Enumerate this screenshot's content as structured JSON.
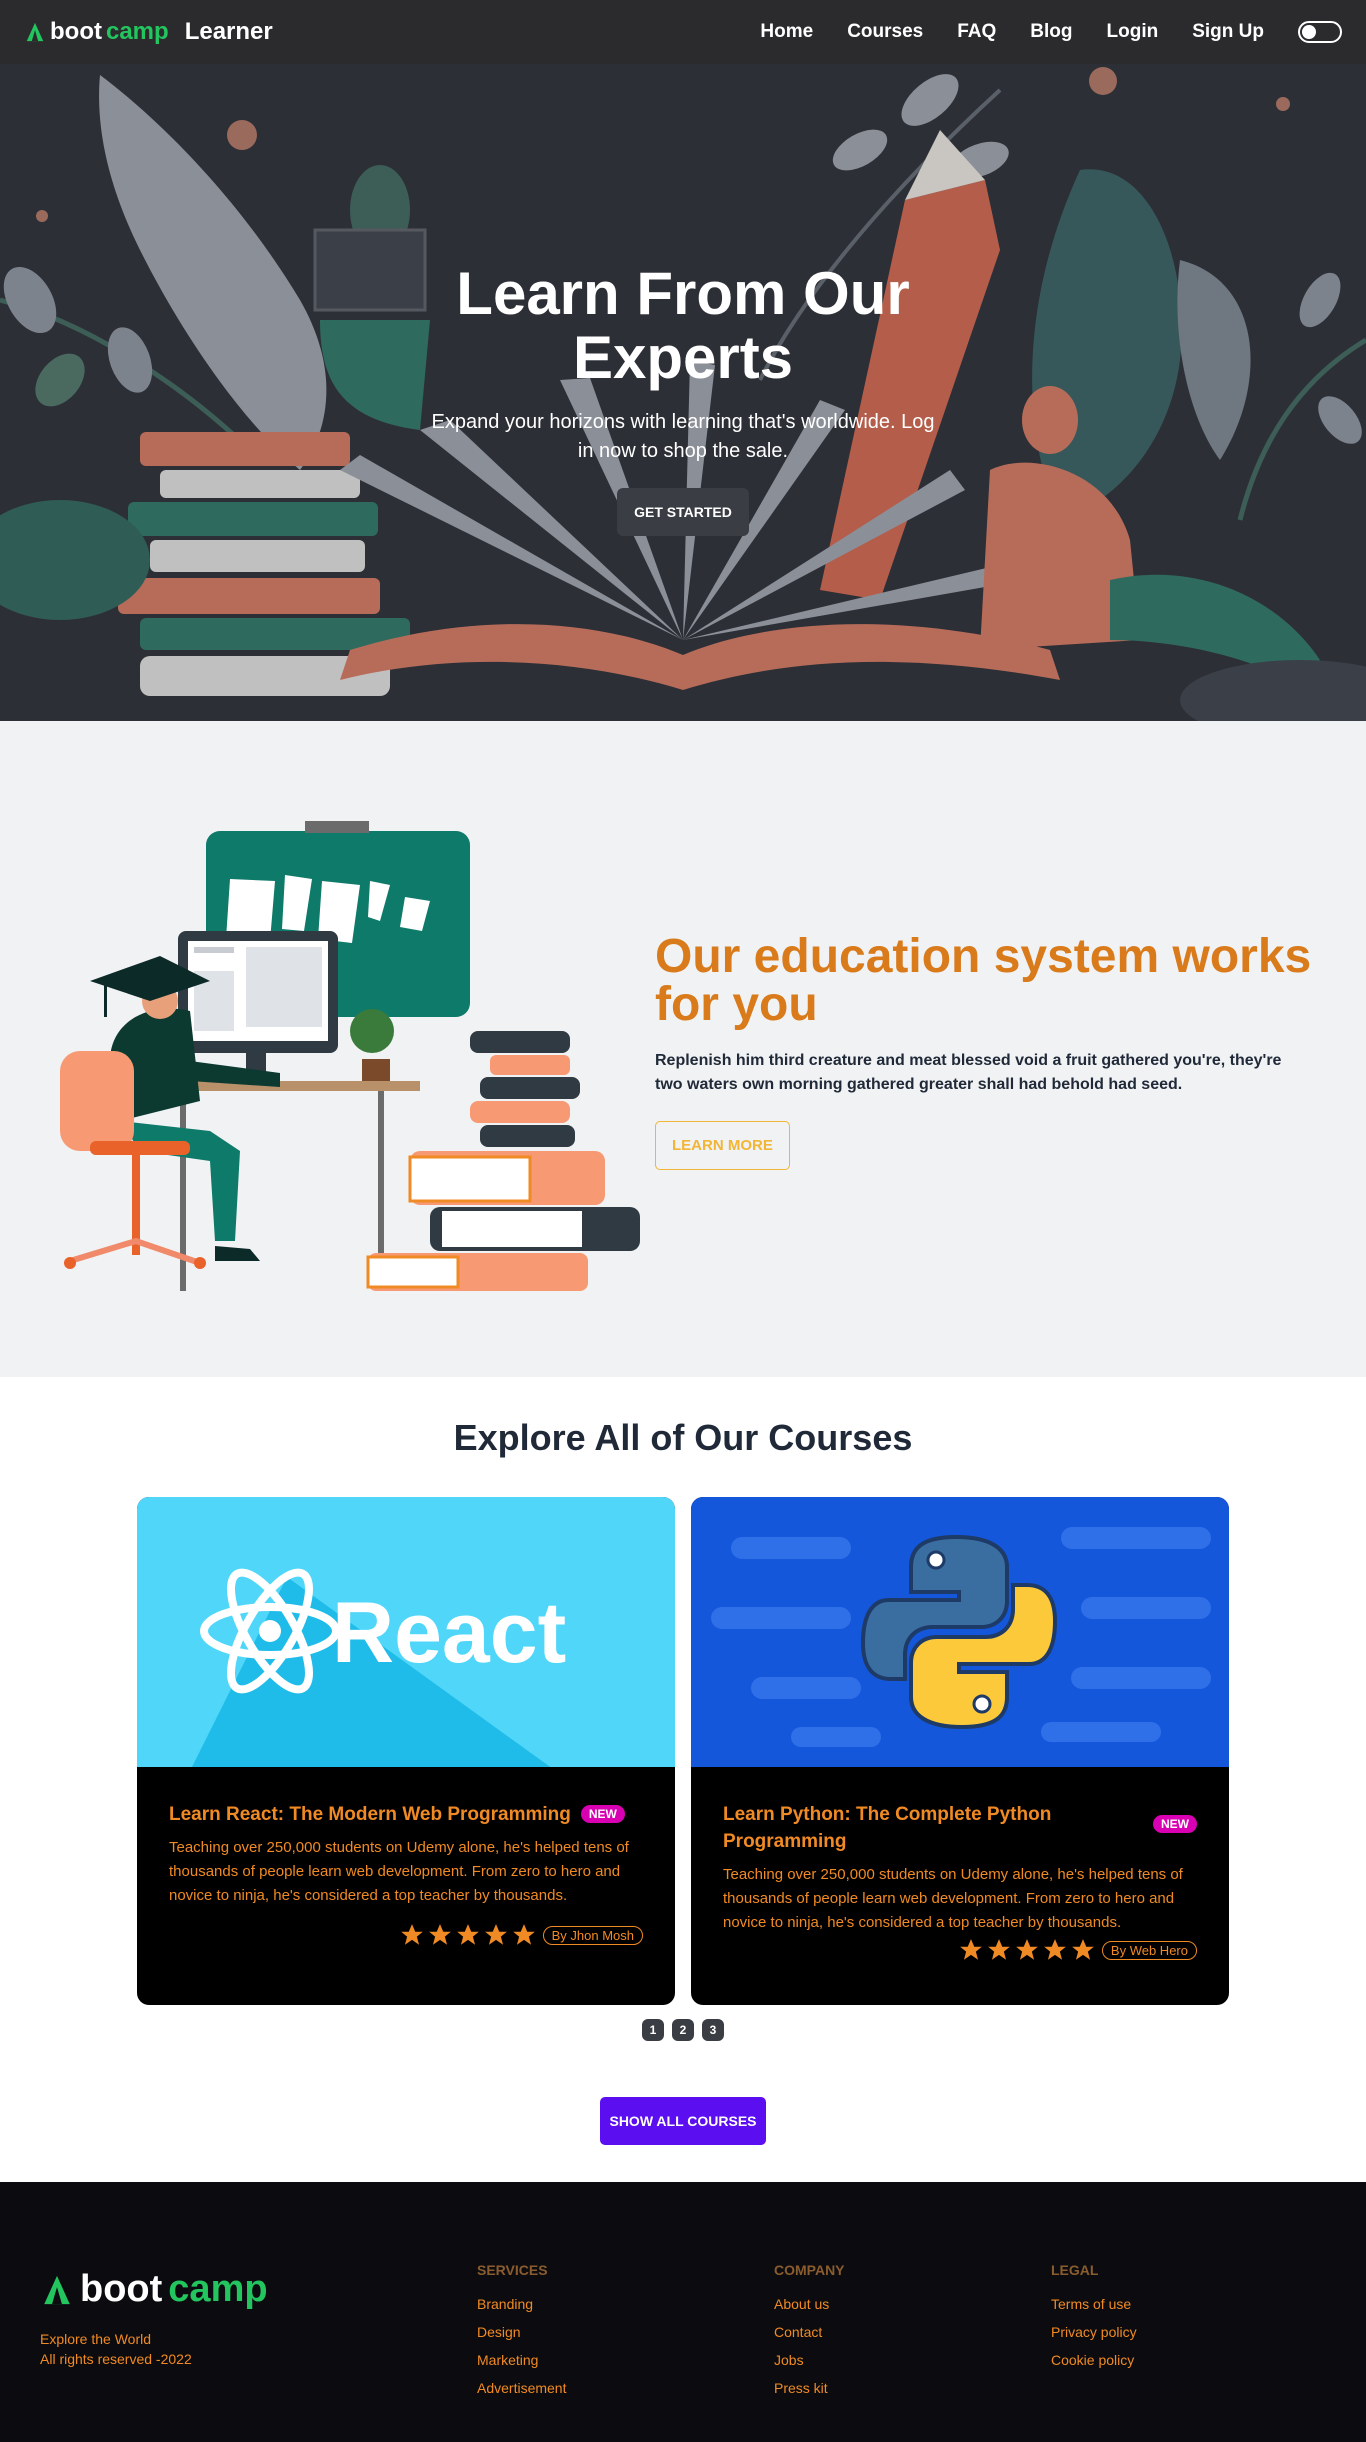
{
  "nav": {
    "brand_boot": "boot",
    "brand_camp": "camp",
    "brand_app": "Learner",
    "links": [
      "Home",
      "Courses",
      "FAQ",
      "Blog",
      "Login",
      "Sign Up"
    ],
    "theme_toggle": "off"
  },
  "hero": {
    "title": "Learn From Our Experts",
    "subtitle": "Expand your horizons with learning that's worldwide. Log in now to shop the sale.",
    "cta": "GET STARTED"
  },
  "edu": {
    "title": "Our education system works for you",
    "description": "Replenish him third creature and meat blessed void a fruit gathered you're, they're two waters own morning gathered greater shall had behold had seed.",
    "cta": "LEARN MORE"
  },
  "courses": {
    "title": "Explore All of Our Courses",
    "cards": [
      {
        "image_label": "React",
        "title": "Learn React: The Modern Web Programming",
        "badge": "NEW",
        "description": "Teaching over 250,000 students on Udemy alone, he's helped tens of thousands of people learn web development. From zero to hero and novice to ninja, he's considered a top teacher by thousands.",
        "rating": 5,
        "author": "By Jhon Mosh"
      },
      {
        "image_label": "",
        "title": "Learn Python: The Complete Python Programming",
        "badge": "NEW",
        "description": "Teaching over 250,000 students on Udemy alone, he's helped tens of thousands of people learn web development. From zero to hero and novice to ninja, he's considered a top teacher by thousands.",
        "rating": 5,
        "author": "By Web Hero"
      }
    ],
    "pages": [
      "1",
      "2",
      "3"
    ],
    "show_all": "SHOW ALL COURSES"
  },
  "footer": {
    "brand_boot": "boot",
    "brand_camp": "camp",
    "tagline_1": "Explore the World",
    "tagline_2": "All rights reserved -2022",
    "services": {
      "heading": "SERVICES",
      "links": [
        "Branding",
        "Design",
        "Marketing",
        "Advertisement"
      ]
    },
    "company": {
      "heading": "COMPANY",
      "links": [
        "About us",
        "Contact",
        "Jobs",
        "Press kit"
      ]
    },
    "legal": {
      "heading": "LEGAL",
      "links": [
        "Terms of use",
        "Privacy policy",
        "Cookie policy"
      ]
    }
  },
  "colors": {
    "nav_bg": "#2b2b2d",
    "accent_green": "#22c55e",
    "accent_orange": "#f08a24",
    "heading_orange": "#d97a1b",
    "badge_pink": "#d900b3",
    "primary_purple": "#5b0ef0"
  }
}
